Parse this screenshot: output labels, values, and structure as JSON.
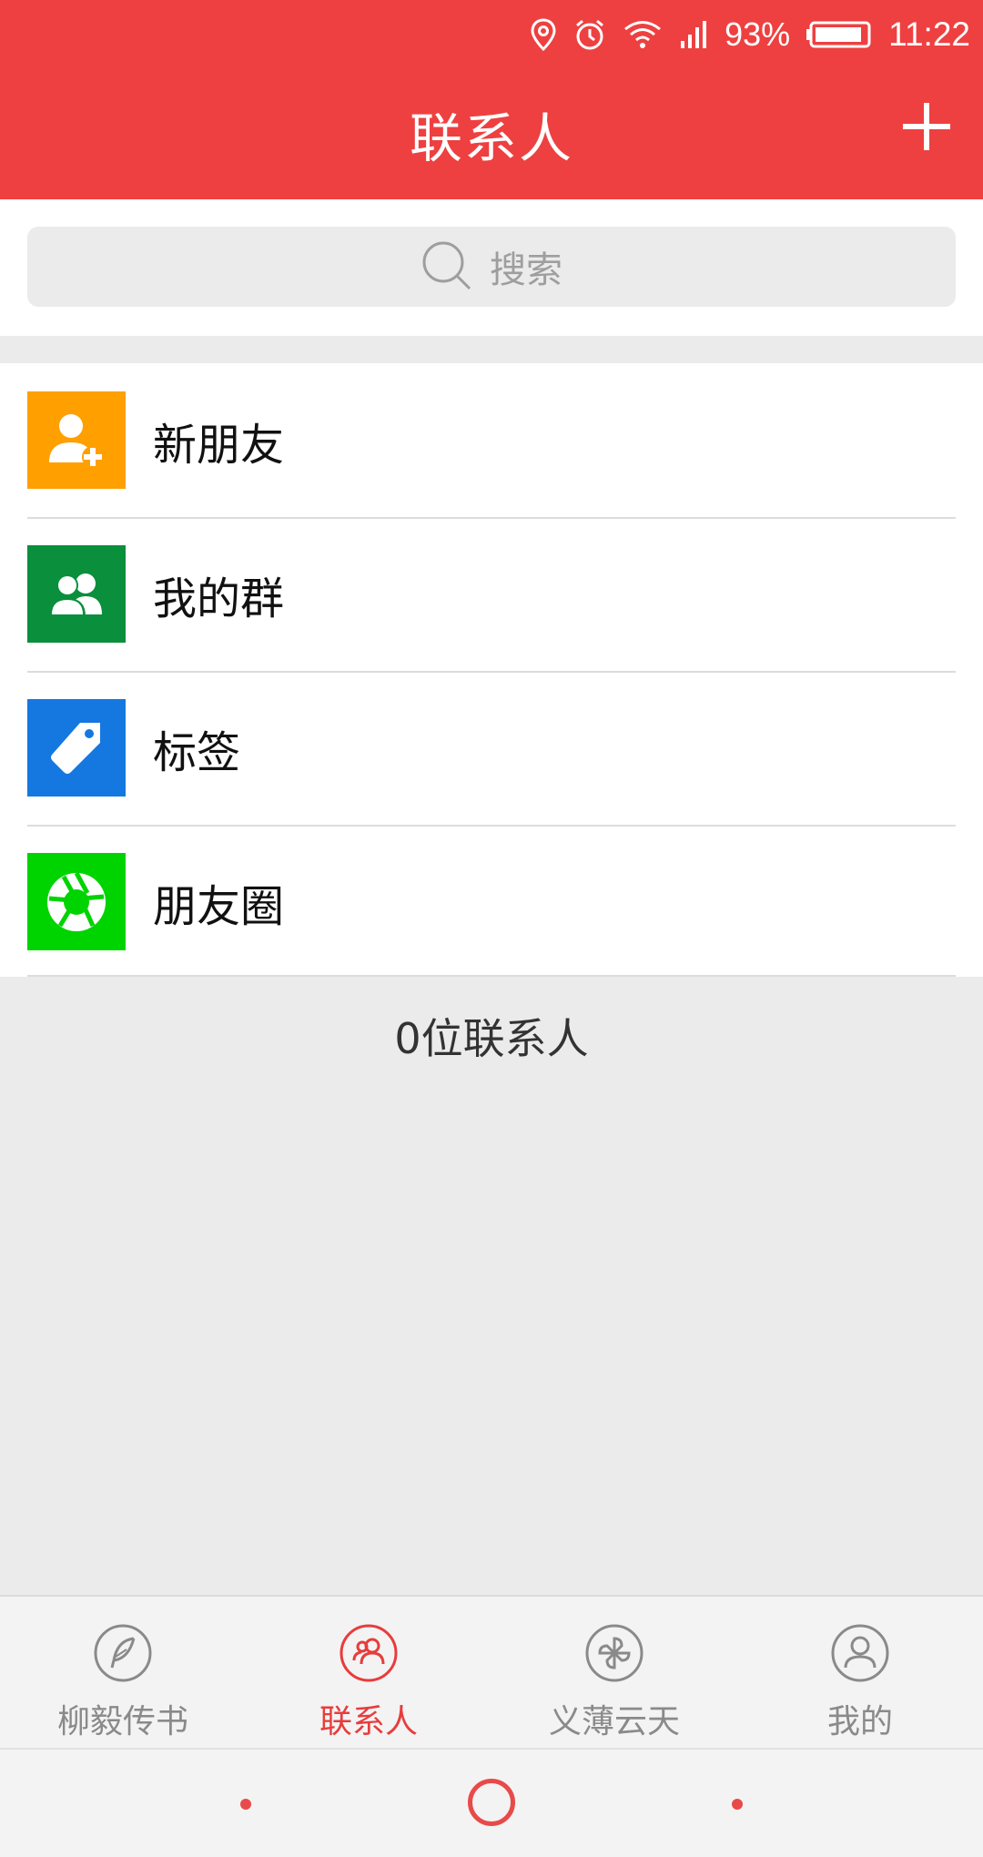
{
  "status_bar": {
    "battery_percent": "93%",
    "time": "11:22",
    "battery_level": 0.93,
    "icons": [
      "location-icon",
      "alarm-icon",
      "wifi-icon",
      "signal-icon",
      "battery-icon"
    ]
  },
  "header": {
    "title": "联系人",
    "add_icon": "plus-icon"
  },
  "search": {
    "placeholder": "搜索",
    "icon": "search-icon"
  },
  "menu": {
    "items": [
      {
        "label": "新朋友",
        "icon": "add-user-icon",
        "color": "#ff9f00"
      },
      {
        "label": "我的群",
        "icon": "group-icon",
        "color": "#0a8f3c"
      },
      {
        "label": "标签",
        "icon": "tag-icon",
        "color": "#1478e0"
      },
      {
        "label": "朋友圈",
        "icon": "aperture-icon",
        "color": "#00d400"
      }
    ]
  },
  "contacts": {
    "count_text": "0位联系人"
  },
  "tabs": {
    "items": [
      {
        "label": "柳毅传书",
        "icon": "feather-icon",
        "active": false
      },
      {
        "label": "联系人",
        "icon": "contacts-icon",
        "active": true
      },
      {
        "label": "义薄云天",
        "icon": "pinwheel-icon",
        "active": false
      },
      {
        "label": "我的",
        "icon": "profile-icon",
        "active": false
      }
    ]
  },
  "colors": {
    "primary": "#ee4040",
    "active_tab": "#e83c3c",
    "inactive_tab": "#8a8a8a",
    "background": "#ebebeb"
  },
  "nav": {
    "icons": [
      "back-dot-icon",
      "home-circle-icon",
      "recents-dot-icon"
    ]
  }
}
